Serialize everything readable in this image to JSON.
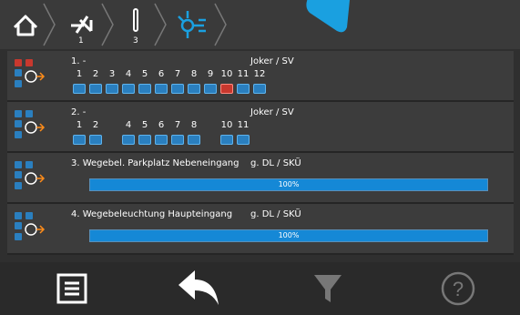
{
  "breadcrumb": {
    "items": [
      {
        "icon": "home-icon"
      },
      {
        "icon": "switch-off-icon",
        "num": "1"
      },
      {
        "icon": "tube-light-icon",
        "num": "3"
      },
      {
        "icon": "lamp-group-icon"
      }
    ]
  },
  "rows": [
    {
      "title": "1. -",
      "right": "Joker / SV",
      "channels": [
        {
          "n": "1",
          "state": "blue"
        },
        {
          "n": "2",
          "state": "blue"
        },
        {
          "n": "3",
          "state": "blue"
        },
        {
          "n": "4",
          "state": "blue"
        },
        {
          "n": "5",
          "state": "blue"
        },
        {
          "n": "6",
          "state": "blue"
        },
        {
          "n": "7",
          "state": "blue"
        },
        {
          "n": "8",
          "state": "blue"
        },
        {
          "n": "9",
          "state": "blue"
        },
        {
          "n": "10",
          "state": "red"
        },
        {
          "n": "11",
          "state": "blue"
        },
        {
          "n": "12",
          "state": "blue"
        }
      ]
    },
    {
      "title": "2. -",
      "right": "Joker / SV",
      "channels": [
        {
          "n": "1",
          "state": "blue"
        },
        {
          "n": "2",
          "state": "blue"
        },
        {
          "n": "4",
          "state": "blue"
        },
        {
          "n": "5",
          "state": "blue"
        },
        {
          "n": "6",
          "state": "blue"
        },
        {
          "n": "7",
          "state": "blue"
        },
        {
          "n": "8",
          "state": "blue"
        },
        {
          "n": "10",
          "state": "blue"
        },
        {
          "n": "11",
          "state": "blue"
        }
      ]
    },
    {
      "title": "3. Wegebel. Parkplatz Nebeneingang",
      "right": "g. DL / SKÜ",
      "progress": 1.0,
      "progress_label": "100%"
    },
    {
      "title": "4. Wegebeleuchtung Haupteingang",
      "right": "g. DL / SKÜ",
      "progress": 1.0,
      "progress_label": "100%"
    }
  ],
  "bottom": {
    "buttons": [
      {
        "icon": "list-icon"
      },
      {
        "icon": "back-arrow-icon"
      },
      {
        "icon": "filter-icon"
      },
      {
        "icon": "help-icon"
      }
    ]
  },
  "colors": {
    "accent": "#1aa0e0",
    "channel_ok": "#2a7fbf",
    "channel_fault": "#c8382e",
    "progress": "#1588d6"
  }
}
